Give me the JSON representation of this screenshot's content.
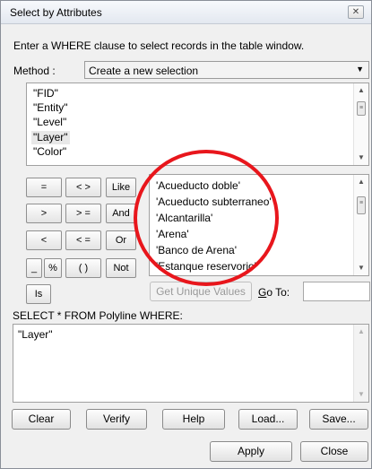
{
  "window": {
    "title": "Select by Attributes",
    "close_glyph": "✕"
  },
  "instruction": "Enter a WHERE clause to select records in the table window.",
  "method": {
    "label": "Method :",
    "value": "Create a new selection"
  },
  "fields": [
    "\"FID\"",
    "\"Entity\"",
    "\"Level\"",
    "\"Layer\"",
    "\"Color\""
  ],
  "selected_field_index": 3,
  "operators": {
    "eq": "=",
    "ne": "< >",
    "like": "Like",
    "gt": ">",
    "ge": "> =",
    "and": "And",
    "lt": "<",
    "le": "< =",
    "or": "Or",
    "underscore": "_",
    "percent": "%",
    "parens": "( )",
    "not": "Not",
    "is": "Is"
  },
  "values": [
    "'Acueducto doble'",
    "'Acueducto subterraneo'",
    "'Alcantarilla'",
    "'Arena'",
    "'Banco de Arena'",
    "'Estanque reservorio'"
  ],
  "get_unique_values": "Get Unique Values",
  "goto": {
    "label": "Go To:",
    "value": ""
  },
  "select_from": "SELECT * FROM Polyline WHERE:",
  "query": "\"Layer\"",
  "buttons": {
    "clear": "Clear",
    "verify": "Verify",
    "help": "Help",
    "load": "Load...",
    "save": "Save...",
    "apply": "Apply",
    "close": "Close"
  },
  "colors": {
    "highlight_circle": "#e8161c"
  }
}
